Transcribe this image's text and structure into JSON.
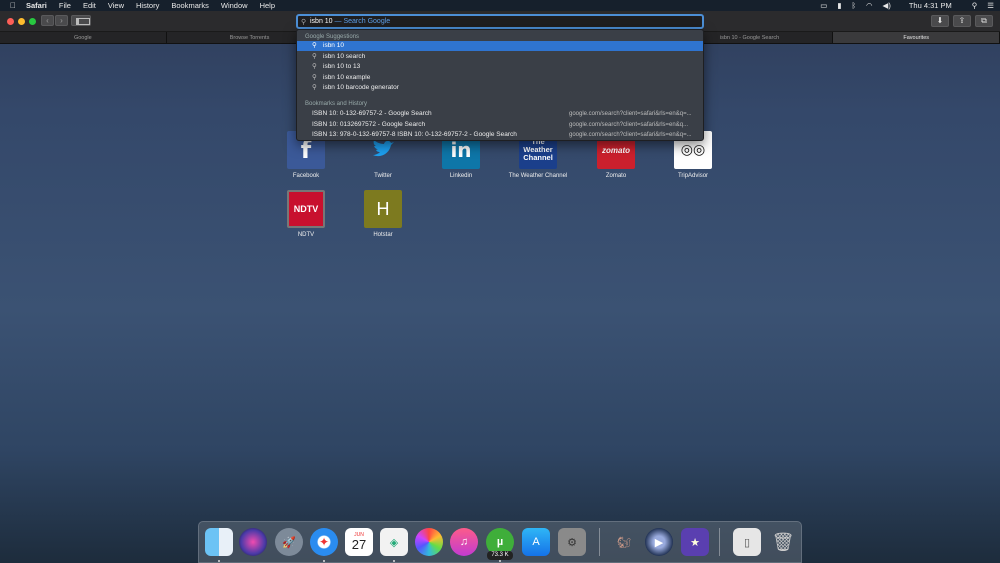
{
  "menubar": {
    "app": "Safari",
    "items": [
      "File",
      "Edit",
      "View",
      "History",
      "Bookmarks",
      "Window",
      "Help"
    ],
    "clock": "Thu 4:31 PM"
  },
  "toolbar": {
    "query": "isbn 10",
    "hint": " — Search Google"
  },
  "tabs": [
    "Google",
    "Browse Torrents",
    "",
    "",
    "isbn 10 - Google Search",
    "Favourites"
  ],
  "suggestions": {
    "google_header": "Google Suggestions",
    "items": [
      "isbn 10",
      "isbn 10 search",
      "isbn 10 to 13",
      "isbn 10 example",
      "isbn 10 barcode generator"
    ],
    "history_header": "Bookmarks and History",
    "history": [
      {
        "title": "ISBN 10: 0-132-69757-2 - Google Search",
        "url": "google.com/search?client=safari&rls=en&q=..."
      },
      {
        "title": "ISBN 10: 0132697572 - Google Search",
        "url": "google.com/search?client=safari&rls=en&q..."
      },
      {
        "title": "ISBN 13: 978-0-132-69757-8 ISBN 10: 0-132-69757-2 - Google Search",
        "url": "google.com/search?client=safari&rls=en&q=..."
      }
    ]
  },
  "favourites": [
    {
      "label": "Facebook",
      "glyph": "f",
      "color": "#3b5998"
    },
    {
      "label": "Twitter",
      "glyph": "🐦",
      "color": "transparent"
    },
    {
      "label": "Linkedin",
      "glyph": "in",
      "color": "#0e76a8"
    },
    {
      "label": "The Weather Channel",
      "glyph": "The Weather Channel",
      "color": "#1b3f8b"
    },
    {
      "label": "Zomato",
      "glyph": "zomato",
      "color": "#cb202d"
    },
    {
      "label": "TripAdvisor",
      "glyph": "◎◎",
      "color": "#ffffff"
    },
    {
      "label": "NDTV",
      "glyph": "NDTV",
      "color": "#c8102e"
    },
    {
      "label": "Hotstar",
      "glyph": "H",
      "color": "#7d7a1f"
    }
  ],
  "dock": {
    "calendar_month": "JUN",
    "calendar_day": "27",
    "utorrent_badge": "73.3 K"
  }
}
